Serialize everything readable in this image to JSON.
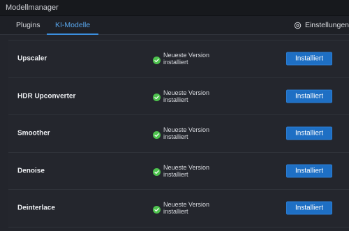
{
  "window": {
    "title": "Modellmanager"
  },
  "tabs": [
    {
      "label": "Plugins"
    },
    {
      "label": "KI-Modelle"
    }
  ],
  "active_tab": "KI-Modelle",
  "settings": {
    "label": "Einstellungen",
    "icon": "gear-icon"
  },
  "colors": {
    "accent": "#3b8fe0",
    "button": "#1e6fc4",
    "check": "#4ec24e"
  },
  "models": [
    {
      "name": "Upscaler",
      "status": "Neueste Version installiert",
      "button": "Installiert"
    },
    {
      "name": "HDR Upconverter",
      "status": "Neueste Version installiert",
      "button": "Installiert"
    },
    {
      "name": "Smoother",
      "status": "Neueste Version installiert",
      "button": "Installiert"
    },
    {
      "name": "Denoise",
      "status": "Neueste Version installiert",
      "button": "Installiert"
    },
    {
      "name": "Deinterlace",
      "status": "Neueste Version installiert",
      "button": "Installiert"
    }
  ]
}
